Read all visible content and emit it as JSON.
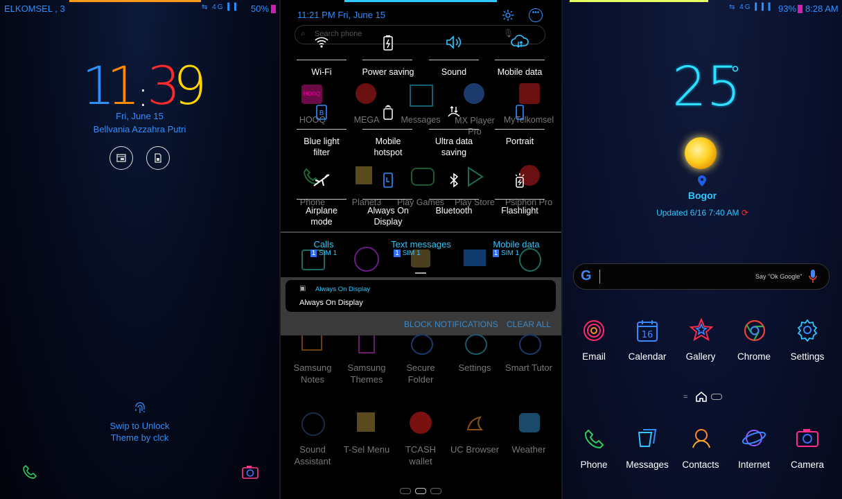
{
  "lock": {
    "carrier": "ELKOMSEL , 3",
    "net": "4G",
    "battery": "50%",
    "time_h1": "1",
    "time_h2": "1",
    "time_colon": ":",
    "time_m1": "3",
    "time_m2": "9",
    "date": "Fri, June 15",
    "owner": "Bellvania Azzahra Putri",
    "unlock_hint": "Swip to Unlock",
    "theme_credit": "Theme by clck",
    "colors": {
      "h1": "#2e8fff",
      "h2": "#ff8a00",
      "m1": "#ff2a2a",
      "m2": "#ffd400"
    }
  },
  "shade": {
    "time": "11:21 PM",
    "date": "Fri, June 15",
    "search_placeholder": "Search phone",
    "tiles": [
      {
        "label": "Wi-Fi",
        "icon": "wifi-icon"
      },
      {
        "label": "Power saving",
        "icon": "battery-saving-icon"
      },
      {
        "label": "Sound",
        "icon": "sound-icon"
      },
      {
        "label": "Mobile data",
        "icon": "mobile-data-icon"
      },
      {
        "label": "Blue light filter",
        "icon": "blue-light-icon"
      },
      {
        "label": "Mobile hotspot",
        "icon": "hotspot-icon"
      },
      {
        "label": "Ultra data saving",
        "icon": "data-saving-icon"
      },
      {
        "label": "Portrait",
        "icon": "portrait-icon"
      },
      {
        "label": "Airplane mode",
        "icon": "airplane-icon"
      },
      {
        "label": "Always On Display",
        "icon": "aod-icon"
      },
      {
        "label": "Bluetooth",
        "icon": "bluetooth-icon"
      },
      {
        "label": "Flashlight",
        "icon": "flashlight-icon"
      }
    ],
    "ghost_apps": [
      "HOOQ",
      "MEGA",
      "Messages",
      "MX Player Pro",
      "MyTelkomsel",
      "Phone",
      "Planet3",
      "Play Games",
      "Play Store",
      "Psiphon Pro"
    ],
    "sim": {
      "calls": "Calls",
      "texts": "Text messages",
      "data": "Mobile data",
      "sim_badge": "1",
      "sim_label": "SIM 1"
    },
    "notification": {
      "app": "Always On Display",
      "text": "Always On Display"
    },
    "block_label": "BLOCK NOTIFICATIONS",
    "clear_label": "CLEAR ALL",
    "drawer_row1": [
      "Samsung Notes",
      "Samsung Themes",
      "Secure Folder",
      "Settings",
      "Smart Tutor"
    ],
    "drawer_row2": [
      "Sound Assistant",
      "T-Sel Menu",
      "TCASH wallet",
      "UC Browser",
      "Weather"
    ]
  },
  "home": {
    "net": "4G",
    "battery": "93%",
    "time": "8:28 AM",
    "temp": "25",
    "degree": "°",
    "city": "Bogor",
    "updated": "Updated 6/16 7:40 AM",
    "search_hint": "Say \"Ok Google\"",
    "apps_row1": [
      "Email",
      "Calendar",
      "Gallery",
      "Chrome",
      "Settings"
    ],
    "calendar_day": "16",
    "apps_row2": [
      "Phone",
      "Messages",
      "Contacts",
      "Internet",
      "Camera"
    ]
  }
}
